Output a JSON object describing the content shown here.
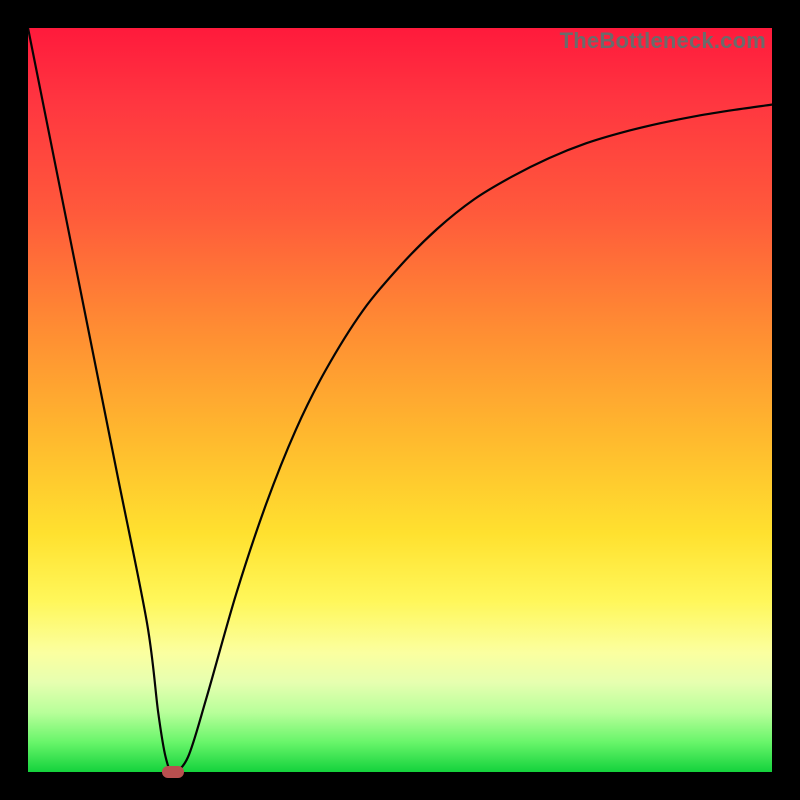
{
  "watermark": "TheBottleneck.com",
  "colors": {
    "frame": "#000000",
    "curve": "#050505",
    "marker": "#b94f4f",
    "gradient_top": "#ff1a3c",
    "gradient_bottom": "#14d23c"
  },
  "chart_data": {
    "type": "line",
    "title": "",
    "xlabel": "",
    "ylabel": "",
    "xlim": [
      0,
      100
    ],
    "ylim": [
      0,
      100
    ],
    "grid": false,
    "legend": false,
    "series": [
      {
        "name": "bottleneck-curve",
        "x": [
          0,
          4,
          8,
          12,
          16,
          17.5,
          18.5,
          19.5,
          21.5,
          24,
          28,
          32,
          36,
          40,
          45,
          50,
          55,
          60,
          65,
          70,
          75,
          80,
          85,
          90,
          95,
          100
        ],
        "y": [
          100,
          80,
          60,
          40,
          20,
          8,
          2,
          0,
          2,
          10,
          24,
          36,
          46,
          54,
          62,
          68,
          73,
          77,
          80,
          82.5,
          84.5,
          86,
          87.2,
          88.2,
          89,
          89.7
        ]
      }
    ],
    "marker": {
      "x": 19.5,
      "y": 0
    },
    "annotations": [
      {
        "text": "TheBottleneck.com",
        "role": "watermark",
        "position": "top-right"
      }
    ]
  }
}
